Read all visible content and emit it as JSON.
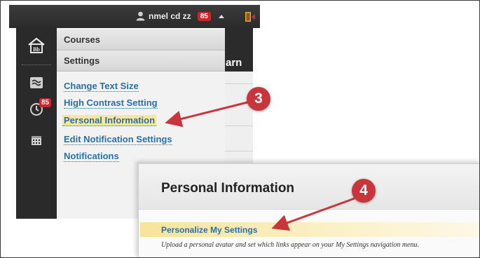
{
  "topbar": {
    "user_name": "nmel cd zz",
    "notification_count": "85"
  },
  "sidebar": {
    "clock_badge": "85"
  },
  "menu": {
    "headers": [
      "Courses",
      "Settings"
    ],
    "links": [
      "Change Text Size",
      "High Contrast Setting",
      "Personal Information",
      "Edit Notification Settings",
      "Notifications"
    ],
    "highlighted": "Personal Information"
  },
  "background": {
    "partial_text": "arn"
  },
  "panel": {
    "title": "Personal Information",
    "link": "Personalize My Settings",
    "description": "Upload a personal avatar and set which links appear on your My Settings navigation menu."
  },
  "callouts": {
    "step3": "3",
    "step4": "4"
  },
  "colors": {
    "accent_red": "#c9353a",
    "link_blue": "#2a6fa8",
    "highlight": "#f7e79a"
  },
  "icons": [
    "user-icon",
    "caret-up-icon",
    "exit-icon",
    "home-icon",
    "waves-icon",
    "clock-icon",
    "calendar-icon"
  ]
}
